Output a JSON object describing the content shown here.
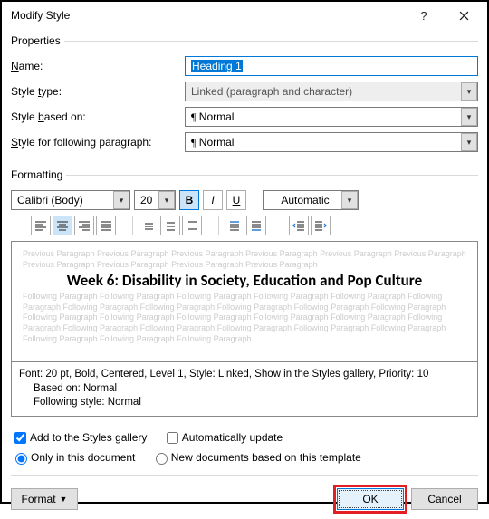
{
  "title": "Modify Style",
  "properties": {
    "legend": "Properties",
    "name_label_pre": "",
    "name_label_u": "N",
    "name_label_post": "ame:",
    "name_value": "Heading 1",
    "type_label_pre": "Style ",
    "type_label_u": "t",
    "type_label_post": "ype:",
    "type_value": "Linked (paragraph and character)",
    "based_label_pre": "Style ",
    "based_label_u": "b",
    "based_label_post": "ased on:",
    "based_value": "Normal",
    "following_label_pre": "",
    "following_label_u": "S",
    "following_label_post": "tyle for following paragraph:",
    "following_value": "Normal"
  },
  "formatting": {
    "legend": "Formatting",
    "font": "Calibri (Body)",
    "size": "20",
    "bold": "B",
    "italic": "I",
    "underline": "U",
    "auto": "Automatic"
  },
  "preview": {
    "before": "Previous Paragraph Previous Paragraph Previous Paragraph Previous Paragraph Previous Paragraph Previous Paragraph Previous Paragraph Previous Paragraph Previous Paragraph Previous Paragraph",
    "sample": "Week 6: Disability in Society, Education and Pop Culture",
    "after": "Following Paragraph Following Paragraph Following Paragraph Following Paragraph Following Paragraph Following Paragraph Following Paragraph Following Paragraph Following Paragraph Following Paragraph Following Paragraph Following Paragraph Following Paragraph Following Paragraph Following Paragraph Following Paragraph Following Paragraph Following Paragraph Following Paragraph Following Paragraph Following Paragraph Following Paragraph Following Paragraph Following Paragraph Following Paragraph"
  },
  "description": {
    "line1": "Font: 20 pt, Bold, Centered, Level 1, Style: Linked, Show in the Styles gallery, Priority: 10",
    "line2": "Based on: Normal",
    "line3": "Following style: Normal"
  },
  "checks": {
    "add_gallery": "Add to the Styles gallery",
    "auto_update": "Automatically update",
    "only_doc": "Only in this document",
    "new_template": "New documents based on this template"
  },
  "buttons": {
    "format": "Format ▾",
    "ok": "OK",
    "cancel": "Cancel"
  }
}
